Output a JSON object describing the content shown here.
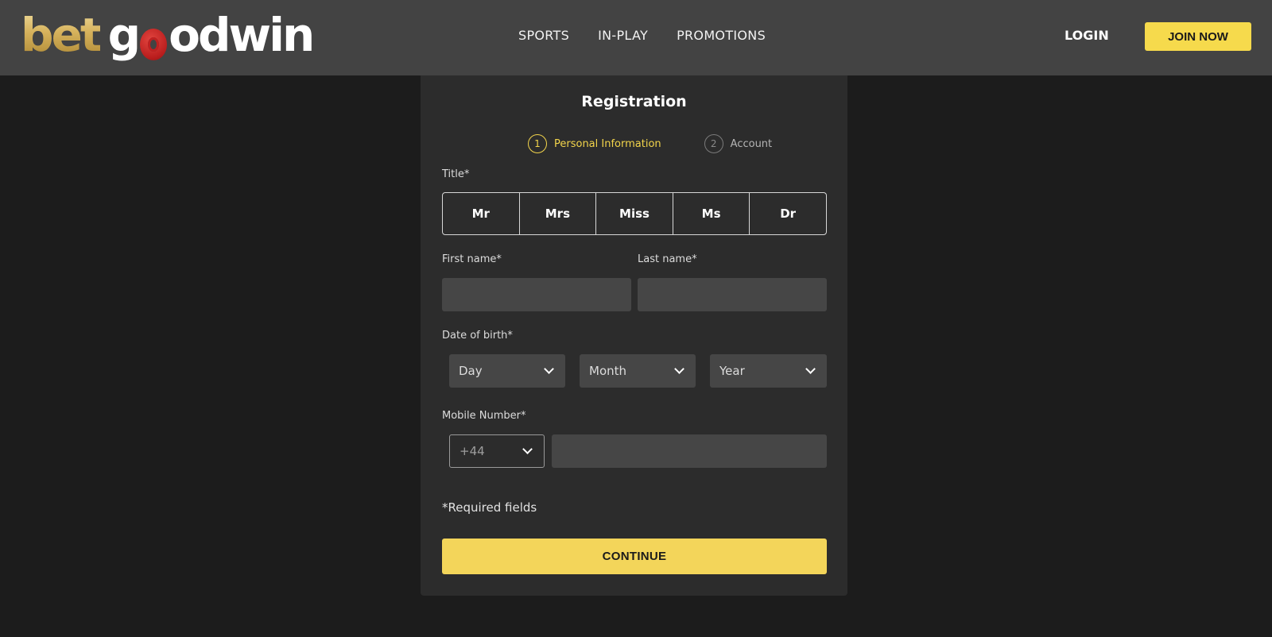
{
  "header": {
    "logo_part1": "bet",
    "logo_part2_before": "g",
    "logo_part2_after": "odwin",
    "nav": [
      "SPORTS",
      "IN-PLAY",
      "PROMOTIONS"
    ],
    "login_label": "LOGIN",
    "join_label": "JOIN NOW"
  },
  "form": {
    "title": "Registration",
    "steps": [
      {
        "num": "1",
        "label": "Personal Information",
        "state": "active"
      },
      {
        "num": "2",
        "label": "Account",
        "state": "inactive"
      }
    ],
    "title_label": "Title*",
    "title_options": [
      "Mr",
      "Mrs",
      "Miss",
      "Ms",
      "Dr"
    ],
    "first_name_label": "First name*",
    "last_name_label": "Last name*",
    "first_name_value": "",
    "last_name_value": "",
    "dob_label": "Date of birth*",
    "dob_day": "Day",
    "dob_month": "Month",
    "dob_year": "Year",
    "mobile_label": "Mobile Number*",
    "country_code": "+44",
    "mobile_value": "",
    "required_note": "*Required fields",
    "continue_label": "CONTINUE"
  },
  "colors": {
    "accent": "#f3d55a",
    "header_bg": "#434343",
    "card_bg": "#2c2c2c",
    "page_bg": "#1c1c1c",
    "input_bg": "#464646",
    "logo_red": "#c02020"
  }
}
